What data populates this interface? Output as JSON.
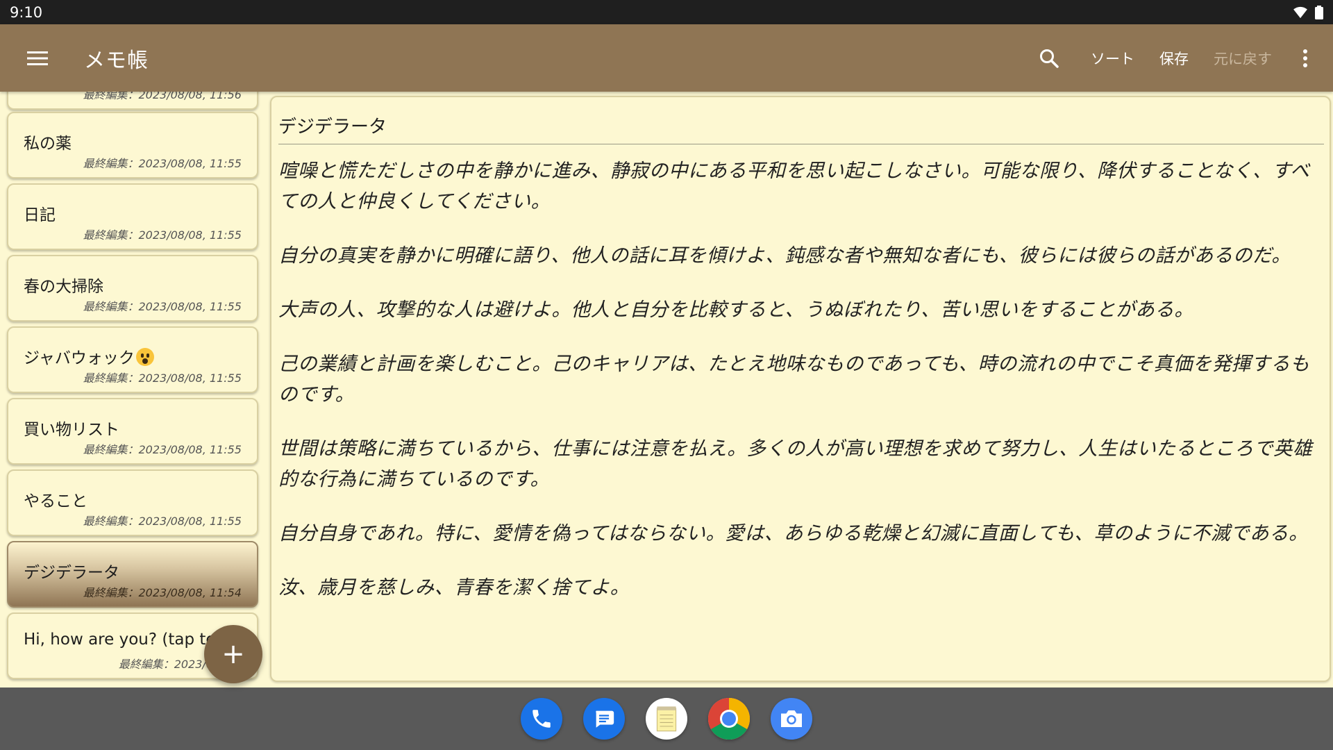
{
  "status_bar": {
    "time": "9:10"
  },
  "app_bar": {
    "title": "メモ帳",
    "actions": {
      "sort": "ソート",
      "save": "保存",
      "undo": "元に戻す"
    }
  },
  "note_list": {
    "partial_top_date": "最終編集：2023/08/08, 11:56",
    "items": [
      {
        "title": "私の薬",
        "date": "最終編集：2023/08/08, 11:55"
      },
      {
        "title": "日記",
        "date": "最終編集：2023/08/08, 11:55"
      },
      {
        "title": "春の大掃除",
        "date": "最終編集：2023/08/08, 11:55"
      },
      {
        "title": "ジャバウォック",
        "date": "最終編集：2023/08/08, 11:55"
      },
      {
        "title": "買い物リスト",
        "date": "最終編集：2023/08/08, 11:55"
      },
      {
        "title": "やること",
        "date": "最終編集：2023/08/08, 11:55"
      },
      {
        "title": "デジデラータ",
        "date": "最終編集：2023/08/08, 11:54"
      },
      {
        "title": "Hi, how are you? (tap to o",
        "date": "最終編集：2023/08/08,"
      }
    ],
    "selected_index": 6
  },
  "fab": {
    "label": "+"
  },
  "editor": {
    "title": "デジデラータ",
    "paragraphs": [
      "喧噪と慌ただしさの中を静かに進み、静寂の中にある平和を思い起こしなさい。可能な限り、降伏することなく、すべての人と仲良くしてください。",
      "自分の真実を静かに明確に語り、他人の話に耳を傾けよ、鈍感な者や無知な者にも、彼らには彼らの話があるのだ。",
      "大声の人、攻撃的な人は避けよ。他人と自分を比較すると、うぬぼれたり、苦い思いをすることがある。",
      "己の業績と計画を楽しむこと。己のキャリアは、たとえ地味なものであっても、時の流れの中でこそ真価を発揮するものです。",
      "世間は策略に満ちているから、仕事には注意を払え。多くの人が高い理想を求めて努力し、人生はいたるところで英雄的な行為に満ちているのです。",
      "自分自身であれ。特に、愛情を偽ってはならない。愛は、あらゆる乾燥と幻滅に直面しても、草のように不滅である。",
      "汝、歳月を慈しみ、青春を潔く捨てよ。"
    ]
  },
  "dock": {
    "apps": [
      "phone-icon",
      "messages-icon",
      "notepad-icon",
      "chrome-icon",
      "camera-icon"
    ]
  },
  "colors": {
    "app_bar": "#8f7554",
    "paper": "#fdf8d2",
    "fab": "#7d6445",
    "dock": "#595959"
  }
}
